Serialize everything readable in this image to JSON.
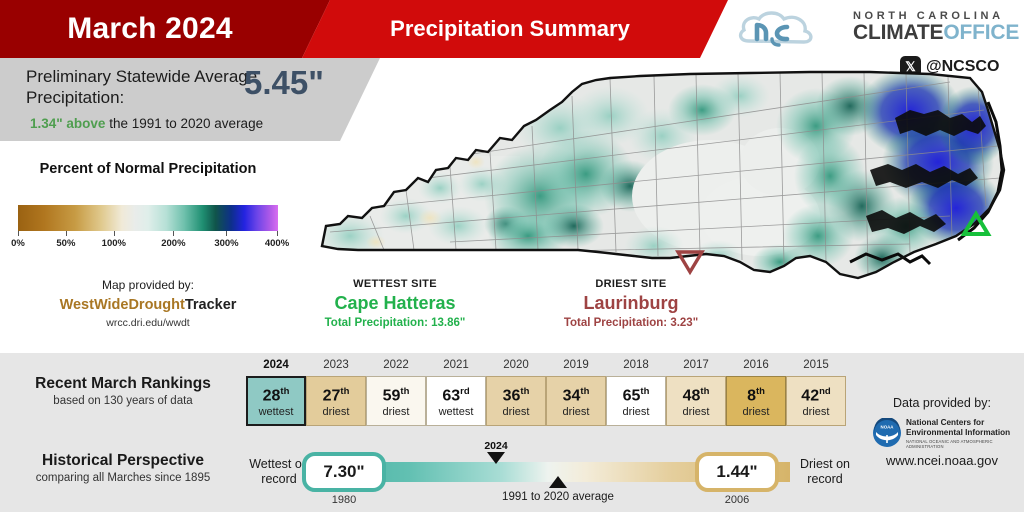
{
  "header": {
    "month_title": "March 2024",
    "subtitle": "Precipitation Summary"
  },
  "logo": {
    "line1": "NORTH CAROLINA",
    "line2_a": "CLIMATE",
    "line2_b": "OFFICE",
    "x_icon": "x-logo-icon",
    "handle": "@NCSCO"
  },
  "stat_panel": {
    "label": "Preliminary Statewide Average Precipitation:",
    "value": "5.45\"",
    "departure_value": "1.34\" above",
    "departure_rest": " the 1991 to 2020 average"
  },
  "legend": {
    "title": "Percent of Normal Precipitation",
    "ticks": [
      "0%",
      "50%",
      "100%",
      "200%",
      "300%",
      "400%"
    ],
    "tick_positions": [
      0,
      18.5,
      37,
      60,
      80.5,
      100
    ],
    "provided_label": "Map provided by:",
    "provider_a": "WestWideDrought",
    "provider_b": "Tracker",
    "provider_url": "wrcc.dri.edu/wwdt"
  },
  "sites": {
    "wettest": {
      "kind": "WETTEST SITE",
      "name": "Cape Hatteras",
      "total": "Total Precipitation: 13.86\"",
      "marker": "green-up-triangle-marker",
      "color": "#22b14c"
    },
    "driest": {
      "kind": "DRIEST SITE",
      "name": "Laurinburg",
      "total": "Total Precipitation: 3.23\"",
      "marker": "red-down-triangle-marker",
      "color": "#9e4343"
    }
  },
  "rankings": {
    "title": "Recent March Rankings",
    "subtitle": "based on 130 years of data",
    "cells": [
      {
        "year": "2024",
        "rank": "28",
        "suffix": "th",
        "kind": "wettest",
        "bg": "#8fc9c4",
        "border": "#1c1c1c",
        "current": true
      },
      {
        "year": "2023",
        "rank": "27",
        "suffix": "th",
        "kind": "driest",
        "bg": "#e3cc9b",
        "border": "#b9a477",
        "current": false
      },
      {
        "year": "2022",
        "rank": "59",
        "suffix": "th",
        "kind": "driest",
        "bg": "#faf7ef",
        "border": "#b9b099",
        "current": false
      },
      {
        "year": "2021",
        "rank": "63",
        "suffix": "rd",
        "kind": "wettest",
        "bg": "#ffffff",
        "border": "#b9b099",
        "current": false
      },
      {
        "year": "2020",
        "rank": "36",
        "suffix": "th",
        "kind": "driest",
        "bg": "#e6d2a8",
        "border": "#b9a477",
        "current": false
      },
      {
        "year": "2019",
        "rank": "34",
        "suffix": "th",
        "kind": "driest",
        "bg": "#e6d2a8",
        "border": "#b9a477",
        "current": false
      },
      {
        "year": "2018",
        "rank": "65",
        "suffix": "th",
        "kind": "driest",
        "bg": "#ffffff",
        "border": "#b9b099",
        "current": false
      },
      {
        "year": "2017",
        "rank": "48",
        "suffix": "th",
        "kind": "driest",
        "bg": "#eee0c2",
        "border": "#b9a477",
        "current": false
      },
      {
        "year": "2016",
        "rank": "8",
        "suffix": "th",
        "kind": "driest",
        "bg": "#dab65e",
        "border": "#9b8344",
        "current": false
      },
      {
        "year": "2015",
        "rank": "42",
        "suffix": "nd",
        "kind": "driest",
        "bg": "#eee0c2",
        "border": "#b9a477",
        "current": false
      }
    ]
  },
  "historical": {
    "title": "Historical Perspective",
    "subtitle": "comparing all Marches since 1895",
    "wettest_label": "Wettest on record",
    "wettest_value": "7.30\"",
    "wettest_year": "1980",
    "driest_label": "Driest on record",
    "driest_value": "1.44\"",
    "driest_year": "2006",
    "current_marker_label": "2024",
    "average_marker_label": "1991 to 2020 average"
  },
  "attribution": {
    "data_label": "Data provided by:",
    "agency_line1": "National Centers for",
    "agency_line2": "Environmental Information",
    "agency_line3": "NATIONAL OCEANIC AND ATMOSPHERIC ADMINISTRATION",
    "url": "www.ncei.noaa.gov"
  },
  "chart_data": {
    "type": "map",
    "title": "Percent of Normal Precipitation",
    "region": "North Carolina",
    "period": "March 2024",
    "statewide_average_in": 5.45,
    "departure_in": 1.34,
    "normal_period": "1991 to 2020",
    "colorbar": {
      "min_pct": 0,
      "max_pct": 400,
      "ticks": [
        0,
        50,
        100,
        200,
        300,
        400
      ]
    },
    "markers": [
      {
        "name": "Cape Hatteras",
        "role": "wettest",
        "total_in": 13.86
      },
      {
        "name": "Laurinburg",
        "role": "driest",
        "total_in": 3.23
      }
    ],
    "rankings_series": {
      "years": [
        2024,
        2023,
        2022,
        2021,
        2020,
        2019,
        2018,
        2017,
        2016,
        2015
      ],
      "ranks": [
        28,
        27,
        59,
        63,
        36,
        34,
        65,
        48,
        8,
        42
      ],
      "kinds": [
        "wettest",
        "driest",
        "driest",
        "wettest",
        "driest",
        "driest",
        "driest",
        "driest",
        "driest",
        "driest"
      ],
      "record_years": 130
    },
    "historical_scale": {
      "wettest_in": 7.3,
      "wettest_year": 1980,
      "driest_in": 1.44,
      "driest_year": 2006,
      "current_in": 5.45,
      "current_year": 2024,
      "normal_in": 4.11
    }
  }
}
